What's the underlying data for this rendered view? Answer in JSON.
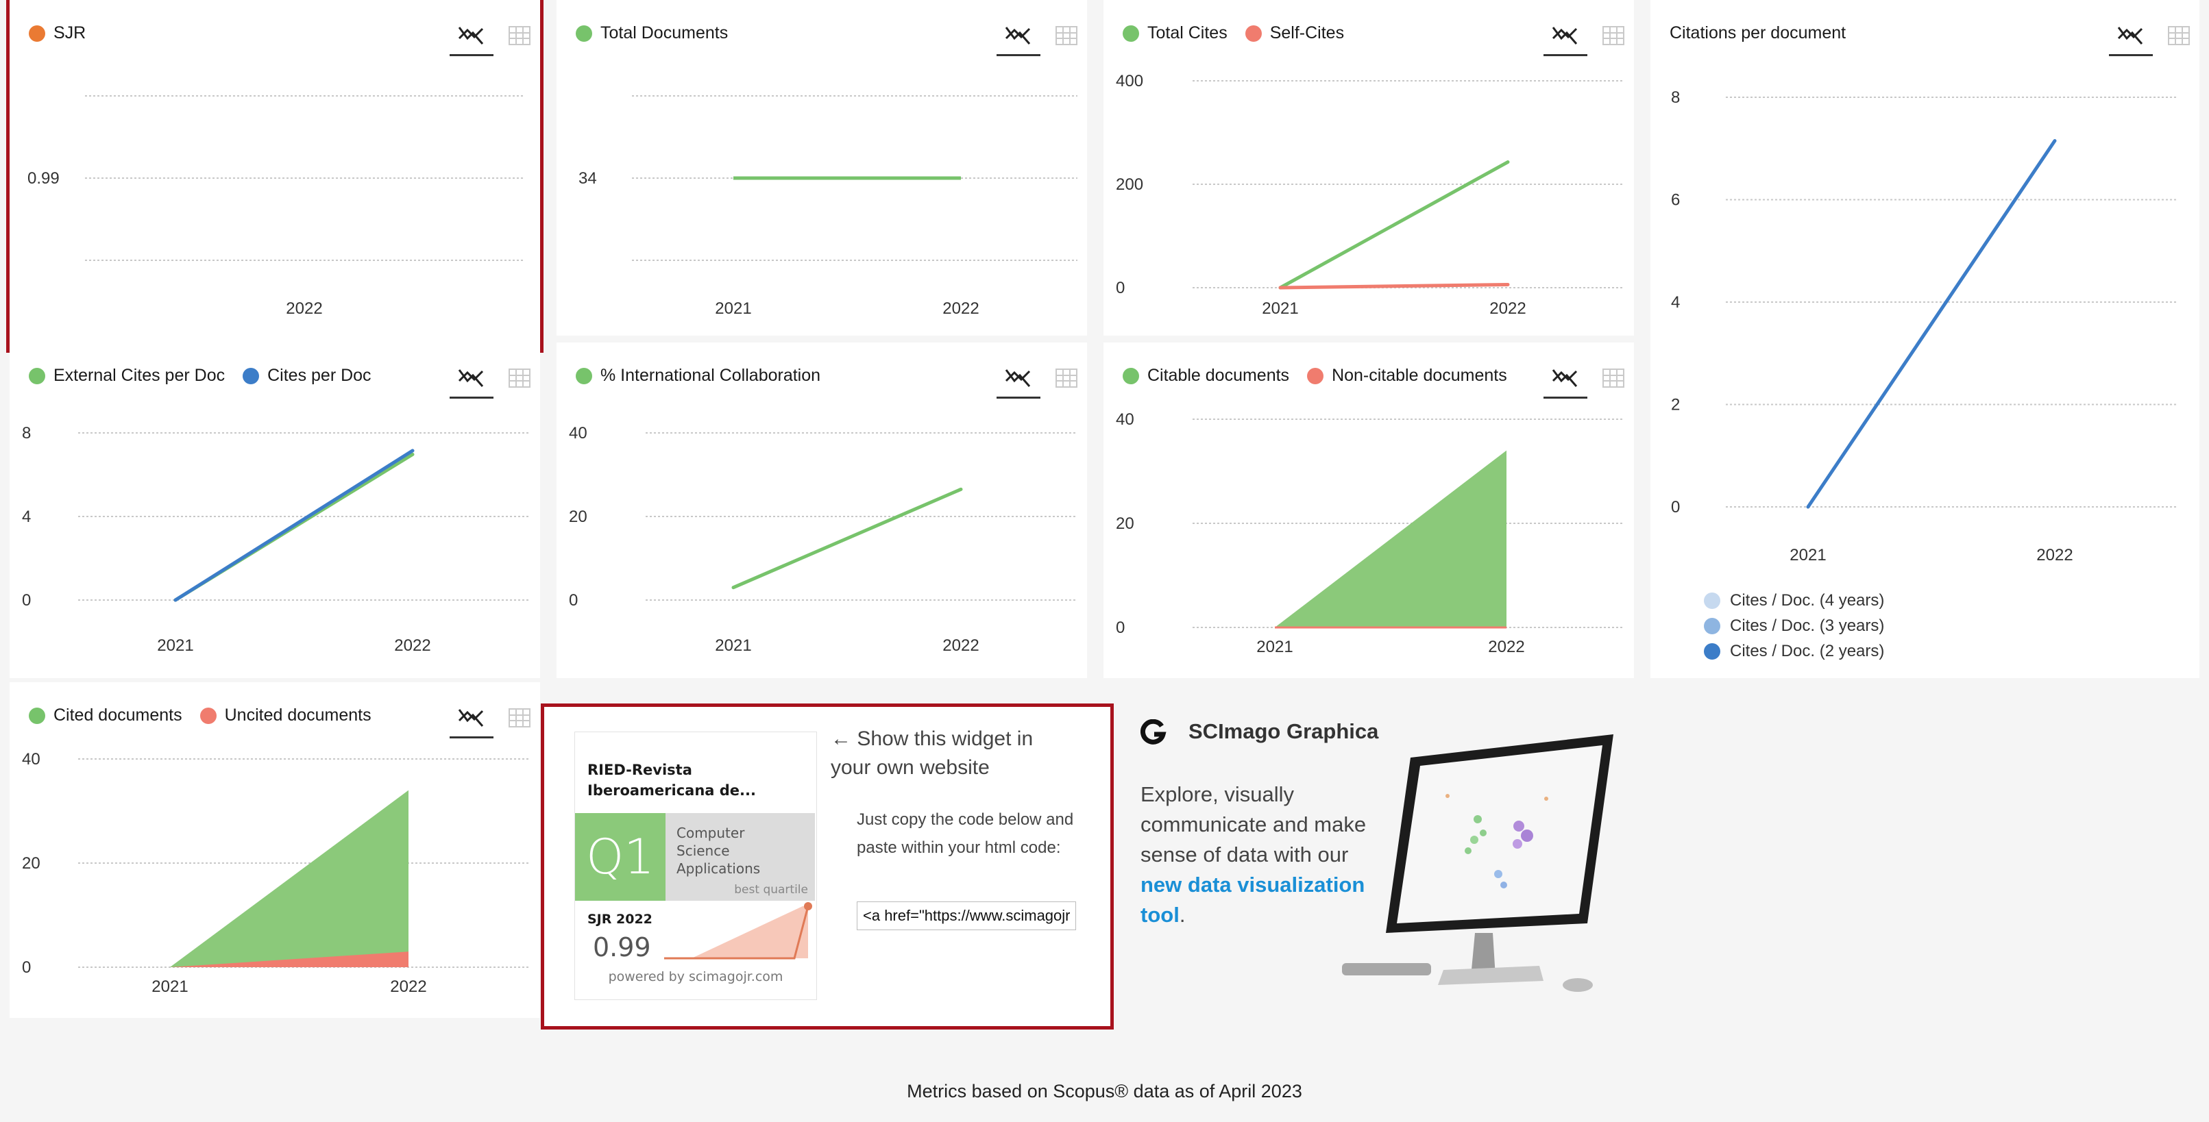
{
  "colors": {
    "orange": "#ea7a33",
    "green": "#77c36b",
    "green_fill": "#8bc97a",
    "red": "#f07c6e",
    "blue": "#3c7dc8",
    "light_blue": "#c6d9ef",
    "mid_blue": "#8eb5e1",
    "grid": "#c8c8c8",
    "highlight": "#a8121d"
  },
  "icons": {
    "chart_toggle": "line-chart-icon",
    "table_toggle": "table-icon"
  },
  "charts": {
    "sjr": {
      "legend": [
        {
          "label": "SJR",
          "color": "#ea7a33"
        }
      ],
      "chart_data": {
        "type": "line",
        "x": [
          "2022"
        ],
        "series": [
          {
            "name": "SJR",
            "values": [
              0.99
            ]
          }
        ],
        "yticks": [
          "0.99"
        ]
      }
    },
    "total_docs": {
      "legend": [
        {
          "label": "Total Documents",
          "color": "#77c36b"
        }
      ],
      "chart_data": {
        "type": "line",
        "x": [
          "2021",
          "2022"
        ],
        "series": [
          {
            "name": "Total Documents",
            "values": [
              34,
              34
            ]
          }
        ],
        "yticks": [
          "34"
        ]
      }
    },
    "cites": {
      "legend": [
        {
          "label": "Total Cites",
          "color": "#77c36b"
        },
        {
          "label": "Self-Cites",
          "color": "#f07c6e"
        }
      ],
      "chart_data": {
        "type": "line",
        "x": [
          "2021",
          "2022"
        ],
        "ylim": [
          0,
          400
        ],
        "yticks": [
          "0",
          "200",
          "400"
        ],
        "series": [
          {
            "name": "Total Cites",
            "values": [
              0,
              243
            ]
          },
          {
            "name": "Self-Cites",
            "values": [
              0,
              6
            ]
          }
        ]
      }
    },
    "cpd": {
      "legend": [
        {
          "label": "Citations per document",
          "color": ""
        }
      ],
      "chart_data": {
        "type": "line",
        "x": [
          "2021",
          "2022"
        ],
        "ylim": [
          0,
          8
        ],
        "yticks": [
          "0",
          "2",
          "4",
          "6",
          "8"
        ],
        "series": [
          {
            "name": "Cites / Doc. (2 years)",
            "values": [
              0,
              7.15
            ]
          }
        ]
      },
      "bottom_legend": [
        {
          "label": "Cites / Doc. (4 years)",
          "color": "#c6d9ef"
        },
        {
          "label": "Cites / Doc. (3 years)",
          "color": "#8eb5e1"
        },
        {
          "label": "Cites / Doc. (2 years)",
          "color": "#3c7dc8"
        }
      ]
    },
    "ext_cites": {
      "legend": [
        {
          "label": "External Cites per Doc",
          "color": "#77c36b"
        },
        {
          "label": "Cites per Doc",
          "color": "#3c7dc8"
        }
      ],
      "chart_data": {
        "type": "line",
        "x": [
          "2021",
          "2022"
        ],
        "ylim": [
          0,
          8
        ],
        "yticks": [
          "0",
          "4",
          "8"
        ],
        "series": [
          {
            "name": "External Cites per Doc",
            "values": [
              0,
              6.97
            ]
          },
          {
            "name": "Cites per Doc",
            "values": [
              0,
              7.15
            ]
          }
        ]
      }
    },
    "intl": {
      "legend": [
        {
          "label": "% International Collaboration",
          "color": "#77c36b"
        }
      ],
      "chart_data": {
        "type": "line",
        "x": [
          "2021",
          "2022"
        ],
        "ylim": [
          0,
          40
        ],
        "yticks": [
          "0",
          "20",
          "40"
        ],
        "series": [
          {
            "name": "% International Collaboration",
            "values": [
              3,
              26.5
            ]
          }
        ]
      }
    },
    "citable": {
      "legend": [
        {
          "label": "Citable documents",
          "color": "#77c36b"
        },
        {
          "label": "Non-citable documents",
          "color": "#f07c6e"
        }
      ],
      "chart_data": {
        "type": "area",
        "x": [
          "2021",
          "2022"
        ],
        "ylim": [
          0,
          40
        ],
        "yticks": [
          "0",
          "20",
          "40"
        ],
        "series": [
          {
            "name": "Citable documents",
            "values": [
              0,
              34
            ]
          },
          {
            "name": "Non-citable documents",
            "values": [
              0,
              0
            ]
          }
        ]
      }
    },
    "cited": {
      "legend": [
        {
          "label": "Cited documents",
          "color": "#77c36b"
        },
        {
          "label": "Uncited documents",
          "color": "#f07c6e"
        }
      ],
      "chart_data": {
        "type": "area",
        "x": [
          "2021",
          "2022"
        ],
        "ylim": [
          0,
          40
        ],
        "yticks": [
          "0",
          "20",
          "40"
        ],
        "series": [
          {
            "name": "Cited documents",
            "values": [
              0,
              31
            ]
          },
          {
            "name": "Uncited documents",
            "values": [
              0,
              3
            ]
          }
        ]
      }
    }
  },
  "widget": {
    "journal": "RIED-Revista Iberoamericana de...",
    "quartile": "Q1",
    "category": "Computer Science Applications",
    "best_quartile": "best quartile",
    "sjr_label": "SJR 2022",
    "sjr_value": "0.99",
    "powered": "powered by scimagojr.com",
    "show_text": "← Show this widget in your own website",
    "copy_text": "Just copy the code below and paste within your html code:",
    "code": "<a href=\"https://www.scimagojr.com"
  },
  "graphica": {
    "title": "SCImago Graphica",
    "desc": "Explore, visually communicate and make sense of data with our",
    "link": "new data visualization tool",
    "after": "."
  },
  "footer": "Metrics based on Scopus® data as of April 2023"
}
